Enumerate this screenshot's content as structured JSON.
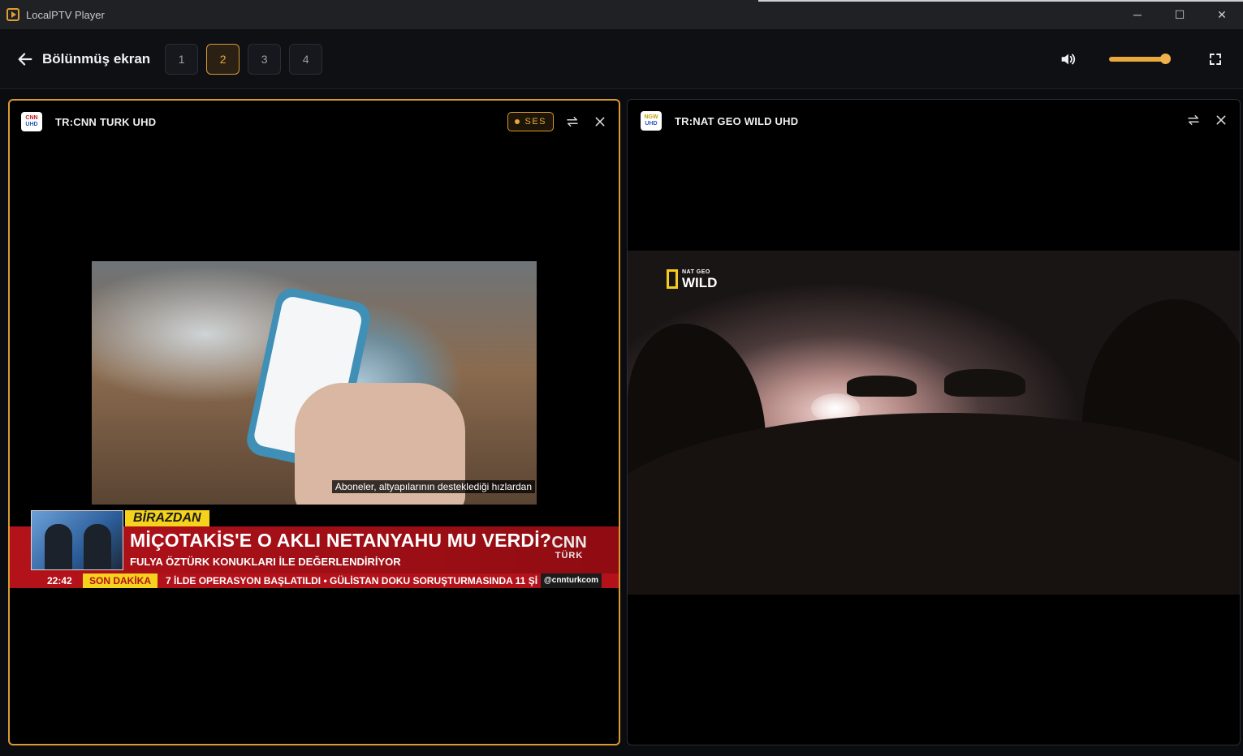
{
  "window": {
    "title": "LocalPTV Player",
    "controls": {
      "minimize": "─",
      "maximize": "☐",
      "close": "✕"
    }
  },
  "toolbar": {
    "title": "Bölünmüş ekran",
    "layouts": [
      {
        "label": "1",
        "active": false
      },
      {
        "label": "2",
        "active": true
      },
      {
        "label": "3",
        "active": false
      },
      {
        "label": "4",
        "active": false
      }
    ],
    "volume_percent": 90
  },
  "panes": [
    {
      "channel_name": "TR:CNN TURK UHD",
      "logo_text": "CNN",
      "logo_sub": "UHD",
      "audio_badge": "SES",
      "video": {
        "subtitle": "Aboneler, altyapılarının desteklediği hızlardan",
        "program_tag": "BİRAZDAN",
        "headline": "MİÇOTAKİS'E O AKLI NETANYAHU MU VERDİ?",
        "subheadline": "FULYA ÖZTÜRK KONUKLARI İLE DEĞERLENDİRİYOR",
        "brand_top": "CNN",
        "brand_bottom": "TÜRK",
        "ticker_time": "22:42",
        "ticker_tag": "SON DAKİKA",
        "ticker_text": "7 İLDE OPERASYON BAŞLATILDI   •   GÜLİSTAN DOKU SORUŞTURMASINDA 11 Şİ",
        "ticker_handle": "@cnnturkcom"
      }
    },
    {
      "channel_name": "TR:NAT GEO WILD UHD",
      "logo_text": "NGW",
      "logo_sub": "UHD",
      "video": {
        "logo_small": "NAT GEO",
        "logo_big": "WILD"
      }
    }
  ],
  "colors": {
    "accent": "#d99a32",
    "background": "#0b0c10"
  },
  "icons": {
    "back": "arrow-left-icon",
    "volume": "volume-icon",
    "fullscreen": "fullscreen-icon",
    "swap": "swap-icon",
    "close": "close-icon"
  }
}
